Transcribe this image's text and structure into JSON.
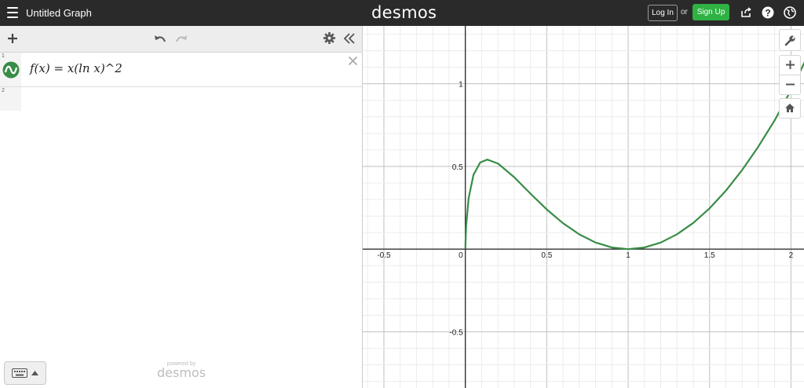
{
  "header": {
    "title": "Untitled Graph",
    "brand": "desmos",
    "login_label": "Log In",
    "or_text": "or",
    "signup_label": "Sign Up"
  },
  "expressions": [
    {
      "number": "1",
      "latex": "f(x) = x(ln x)^2",
      "color": "#388c46"
    },
    {
      "number": "2",
      "latex": ""
    }
  ],
  "footer": {
    "powered_by": "powered by",
    "brand": "desmos"
  },
  "icons": [
    "menu-icon",
    "share-icon",
    "help-icon",
    "globe-icon",
    "plus-icon",
    "undo-icon",
    "redo-icon",
    "gear-icon",
    "collapse-icon",
    "close-icon",
    "wrench-icon",
    "zoom-in-icon",
    "zoom-out-icon",
    "home-icon",
    "keyboard-icon"
  ],
  "chart_data": {
    "type": "line",
    "series": [
      {
        "name": "f(x) = x(ln x)^2",
        "color": "#388c46",
        "x": [
          0.0001,
          0.005,
          0.02,
          0.05,
          0.0916,
          0.135,
          0.2,
          0.3,
          0.4,
          0.5,
          0.6,
          0.7,
          0.8,
          0.9,
          1.0,
          1.1,
          1.2,
          1.3,
          1.4,
          1.5,
          1.6,
          1.7,
          1.8,
          1.9,
          2.0,
          2.1
        ],
        "y": [
          0.0085,
          0.1403,
          0.3061,
          0.4487,
          0.5237,
          0.5413,
          0.5181,
          0.4349,
          0.3358,
          0.2402,
          0.1565,
          0.089,
          0.0398,
          0.01,
          0.0,
          0.01,
          0.0399,
          0.0895,
          0.1585,
          0.2466,
          0.3533,
          0.4781,
          0.6203,
          0.7793,
          0.9609,
          1.1628
        ]
      }
    ],
    "xlim": [
      -0.63,
      2.08
    ],
    "ylim": [
      -0.84,
      1.35
    ],
    "x_ticks": [
      -0.5,
      0,
      0.5,
      1,
      1.5,
      2
    ],
    "y_ticks": [
      1,
      0.5,
      -0.5
    ],
    "tick_labels_x": [
      "-0.5",
      "0",
      "0.5",
      "1",
      "1.5",
      "2"
    ],
    "tick_labels_y": [
      "1",
      "0.5",
      "-0.5"
    ],
    "grid": true
  }
}
